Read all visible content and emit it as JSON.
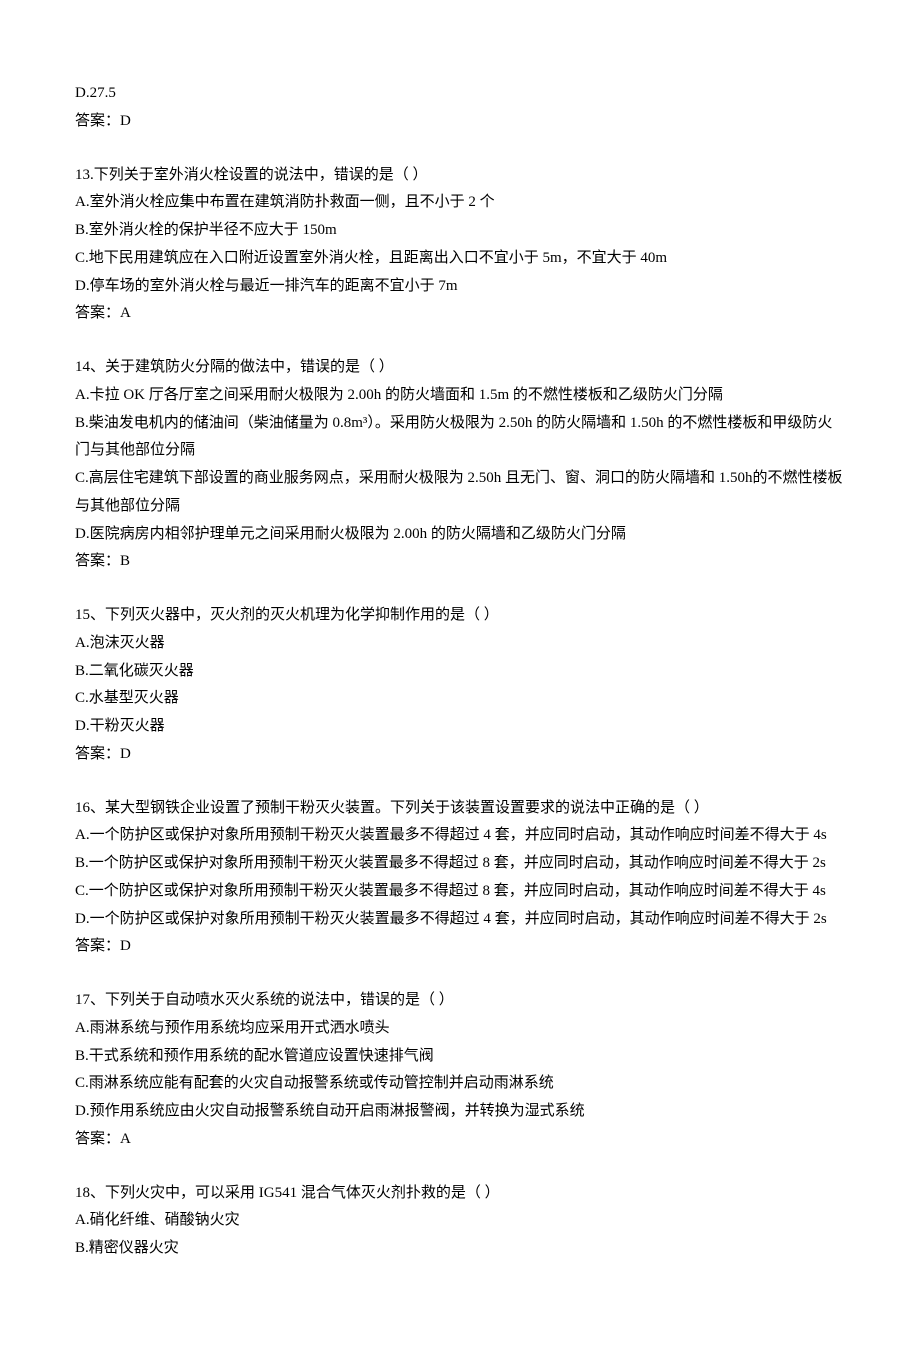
{
  "q12_tail": {
    "option_d": "D.27.5",
    "answer": "答案：D"
  },
  "q13": {
    "stem": "13.下列关于室外消火栓设置的说法中，错误的是（    ）",
    "a": "A.室外消火栓应集中布置在建筑消防扑救面一侧，且不小于 2 个",
    "b": "B.室外消火栓的保护半径不应大于 150m",
    "c": "C.地下民用建筑应在入口附近设置室外消火栓，且距离出入口不宜小于 5m，不宜大于 40m",
    "d": "D.停车场的室外消火栓与最近一排汽车的距离不宜小于 7m",
    "answer": "答案：A"
  },
  "q14": {
    "stem": "14、关于建筑防火分隔的做法中，错误的是（    ）",
    "a": "A.卡拉 OK 厅各厅室之间采用耐火极限为 2.00h 的防火墙面和 1.5m 的不燃性楼板和乙级防火门分隔",
    "b": "B.柴油发电机内的储油间（柴油储量为 0.8m³）。采用防火极限为 2.50h 的防火隔墙和 1.50h 的不燃性楼板和甲级防火门与其他部位分隔",
    "c": "C.高层住宅建筑下部设置的商业服务网点，采用耐火极限为 2.50h 且无门、窗、洞口的防火隔墙和 1.50h的不燃性楼板与其他部位分隔",
    "d": "D.医院病房内相邻护理单元之间采用耐火极限为 2.00h 的防火隔墙和乙级防火门分隔",
    "answer": "答案：B"
  },
  "q15": {
    "stem": "15、下列灭火器中，灭火剂的灭火机理为化学抑制作用的是（    ）",
    "a": "A.泡沫灭火器",
    "b": "B.二氧化碳灭火器",
    "c": "C.水基型灭火器",
    "d": "D.干粉灭火器",
    "answer": "答案：D"
  },
  "q16": {
    "stem": "16、某大型钢铁企业设置了预制干粉灭火装置。下列关于该装置设置要求的说法中正确的是（    ）",
    "a": "A.一个防护区或保护对象所用预制干粉灭火装置最多不得超过 4 套，并应同时启动，其动作响应时间差不得大于 4s",
    "b": "B.一个防护区或保护对象所用预制干粉灭火装置最多不得超过 8 套，并应同时启动，其动作响应时间差不得大于 2s",
    "c": "C.一个防护区或保护对象所用预制干粉灭火装置最多不得超过 8 套，并应同时启动，其动作响应时间差不得大于 4s",
    "d": "D.一个防护区或保护对象所用预制干粉灭火装置最多不得超过 4 套，并应同时启动，其动作响应时间差不得大于 2s",
    "answer": "答案：D"
  },
  "q17": {
    "stem": "17、下列关于自动喷水灭火系统的说法中，错误的是（    ）",
    "a": "A.雨淋系统与预作用系统均应采用开式洒水喷头",
    "b": "B.干式系统和预作用系统的配水管道应设置快速排气阀",
    "c": "C.雨淋系统应能有配套的火灾自动报警系统或传动管控制并启动雨淋系统",
    "d": "D.预作用系统应由火灾自动报警系统自动开启雨淋报警阀，并转换为湿式系统",
    "answer": "答案：A"
  },
  "q18": {
    "stem": "18、下列火灾中，可以采用 IG541 混合气体灭火剂扑救的是（    ）",
    "a": "A.硝化纤维、硝酸钠火灾",
    "b": "B.精密仪器火灾"
  }
}
